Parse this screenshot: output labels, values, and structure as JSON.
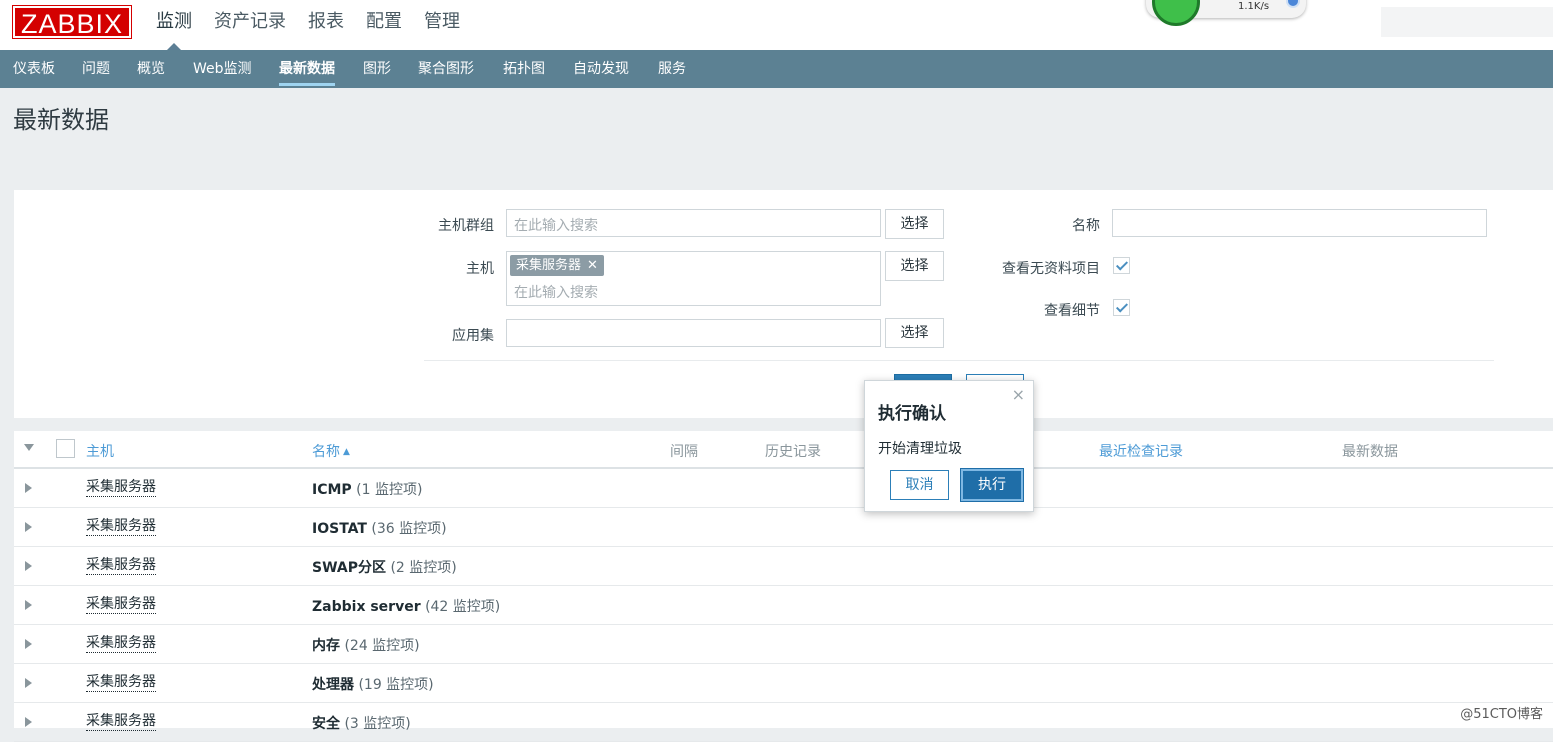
{
  "header": {
    "logo": "ZABBIX",
    "menu": [
      "监测",
      "资产记录",
      "报表",
      "配置",
      "管理"
    ],
    "active_menu": "监测",
    "widget_speed": "1.1K/s"
  },
  "submenu": {
    "items": [
      "仪表板",
      "问题",
      "概览",
      "Web监测",
      "最新数据",
      "图形",
      "聚合图形",
      "拓扑图",
      "自动发现",
      "服务"
    ],
    "active": "最新数据"
  },
  "page_title": "最新数据",
  "filter": {
    "host_group_label": "主机群组",
    "host_group_placeholder": "在此输入搜索",
    "host_label": "主机",
    "host_tag": "采集服务器",
    "host_placeholder": "在此输入搜索",
    "app_label": "应用集",
    "select_label": "选择",
    "name_label": "名称",
    "show_without_data_label": "查看无资料项目",
    "show_without_data": true,
    "show_details_label": "查看细节",
    "show_details": true
  },
  "table": {
    "columns": {
      "host": "主机",
      "name": "名称",
      "interval": "间隔",
      "history": "历史记录",
      "last_check": "最近检查记录",
      "last_value": "最新数据"
    },
    "rows": [
      {
        "host": "采集服务器",
        "app": "ICMP",
        "count": "(1 监控项)"
      },
      {
        "host": "采集服务器",
        "app": "IOSTAT",
        "count": "(36 监控项)"
      },
      {
        "host": "采集服务器",
        "app": "SWAP分区",
        "count": "(2 监控项)"
      },
      {
        "host": "采集服务器",
        "app": "Zabbix server",
        "count": "(42 监控项)"
      },
      {
        "host": "采集服务器",
        "app": "内存",
        "count": "(24 监控项)"
      },
      {
        "host": "采集服务器",
        "app": "处理器",
        "count": "(19 监控项)"
      },
      {
        "host": "采集服务器",
        "app": "安全",
        "count": "(3 监控项)"
      }
    ]
  },
  "dialog": {
    "title": "执行确认",
    "close": "×",
    "message": "开始清理垃圾",
    "cancel": "取消",
    "execute": "执行"
  },
  "watermark": "@51CTO博客",
  "colors": {
    "brand": "#d40000",
    "submenu_bg": "#5c8193",
    "link": "#4d9bd6",
    "primary_button": "#1f6ea8"
  }
}
